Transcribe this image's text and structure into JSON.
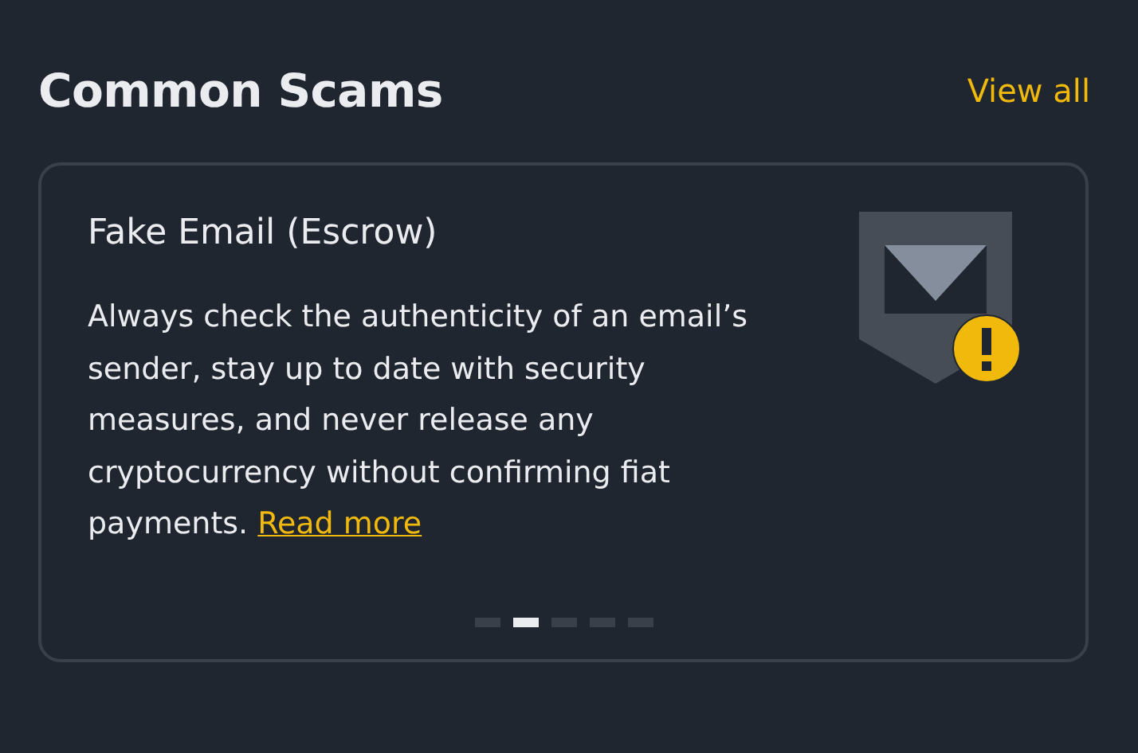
{
  "header": {
    "title": "Common Scams",
    "link": "View all"
  },
  "card": {
    "title": "Fake Email (Escrow)",
    "body": "Always check the authenticity of an email’s sender, stay up to date with security measures, and never release any cryptocurrency without confirming fiat payments.",
    "link": "Read more"
  },
  "pager": [
    {
      "selected": false
    },
    {
      "selected": true
    },
    {
      "selected": false
    },
    {
      "selected": false
    },
    {
      "selected": false
    }
  ]
}
